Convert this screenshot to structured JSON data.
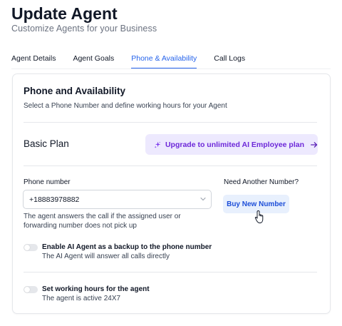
{
  "header": {
    "title": "Update Agent",
    "subtitle": "Customize Agents for your Business"
  },
  "tabs": [
    {
      "label": "Agent Details",
      "active": false
    },
    {
      "label": "Agent Goals",
      "active": false
    },
    {
      "label": "Phone & Availability",
      "active": true
    },
    {
      "label": "Call Logs",
      "active": false
    }
  ],
  "section": {
    "title": "Phone and Availability",
    "description": "Select a Phone Number and define working hours for your Agent"
  },
  "plan": {
    "title": "Basic Plan",
    "upgrade_label": "Upgrade to unlimited AI Employee plan"
  },
  "phone": {
    "label": "Phone number",
    "value": "+18883978882",
    "helper": "The agent answers the call if the assigned user or forwarding number does not pick up"
  },
  "buy": {
    "label": "Need Another Number?",
    "button": "Buy New Number"
  },
  "toggles": [
    {
      "title": "Enable AI Agent as a backup to the phone number",
      "subtitle": "The AI Agent will answer all calls directly",
      "on": false
    },
    {
      "title": "Set working hours for the agent",
      "subtitle": "The agent is active 24X7",
      "on": false
    }
  ],
  "colors": {
    "accent": "#2563eb",
    "upgrade_bg": "#ede9fe",
    "upgrade_text": "#6d28d9",
    "buy_bg": "#e8f0fd"
  },
  "icons": [
    "sparkle-icon",
    "arrow-right-icon",
    "chevron-down-icon",
    "hand-pointer-cursor"
  ]
}
